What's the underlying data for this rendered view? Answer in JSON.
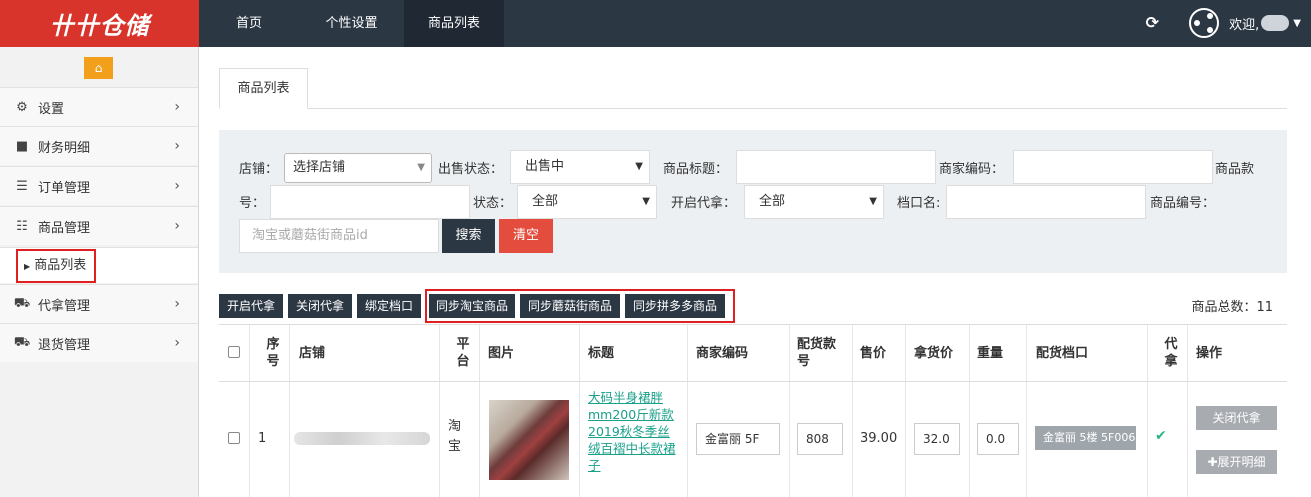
{
  "header": {
    "logo_text": "卄卄仓储",
    "nav": [
      {
        "label": "首页"
      },
      {
        "label": "个性设置"
      },
      {
        "label": "商品列表"
      }
    ],
    "welcome": "欢迎,"
  },
  "sidebar": {
    "items": [
      {
        "label": "设置",
        "icon": "gears-icon"
      },
      {
        "label": "财务明细",
        "icon": "briefcase-icon"
      },
      {
        "label": "订单管理",
        "icon": "bars-icon"
      },
      {
        "label": "商品管理",
        "icon": "list-icon"
      },
      {
        "label": "代拿管理",
        "icon": "cart-icon"
      },
      {
        "label": "退货管理",
        "icon": "truck-icon"
      }
    ],
    "sub_item": "商品列表"
  },
  "main": {
    "tab": "商品列表",
    "filter": {
      "store_label": "店铺：",
      "store_value": "选择店铺",
      "sale_status_label": "出售状态：",
      "sale_status_value": "出售中",
      "title_label": "商品标题：",
      "merchant_code_label": "商家编码：",
      "style_no_label_1": "商品款",
      "style_no_label_2": "号：",
      "status_label": "状态：",
      "status_value": "全部",
      "proxy_label": "开启代拿：",
      "proxy_value": "全部",
      "stall_label": "档口名:",
      "goods_no_label": "商品编号：",
      "id_placeholder": "淘宝或蘑菇街商品id",
      "search_button": "搜索",
      "clear_button": "清空"
    },
    "actions": [
      "开启代拿",
      "关闭代拿",
      "绑定档口",
      "同步淘宝商品",
      "同步蘑菇街商品",
      "同步拼多多商品"
    ],
    "total": "商品总数：11",
    "table": {
      "headers": {
        "seq_1": "序",
        "seq_2": "号",
        "store": "店铺",
        "platform_1": "平",
        "platform_2": "台",
        "image": "图片",
        "title": "标题",
        "merchant_code": "商家编码",
        "style_1": "配货款",
        "style_2": "号",
        "price": "售价",
        "take_price": "拿货价",
        "weight": "重量",
        "stall": "配货档口",
        "proxy_1": "代",
        "proxy_2": "拿",
        "ops": "操作"
      },
      "row": {
        "seq": "1",
        "platform_1": "淘",
        "platform_2": "宝",
        "title": "大码半身裙胖mm200斤新款2019秋冬季丝绒百褶中长款裙子",
        "merchant_code": "金富丽 5F",
        "style_no": "808",
        "price": "39.00",
        "take_price": "32.0",
        "weight": "0.0",
        "stall": "金富丽 5楼 5F006",
        "close_proxy": "关闭代拿",
        "expand": "✚展开明细"
      }
    }
  }
}
